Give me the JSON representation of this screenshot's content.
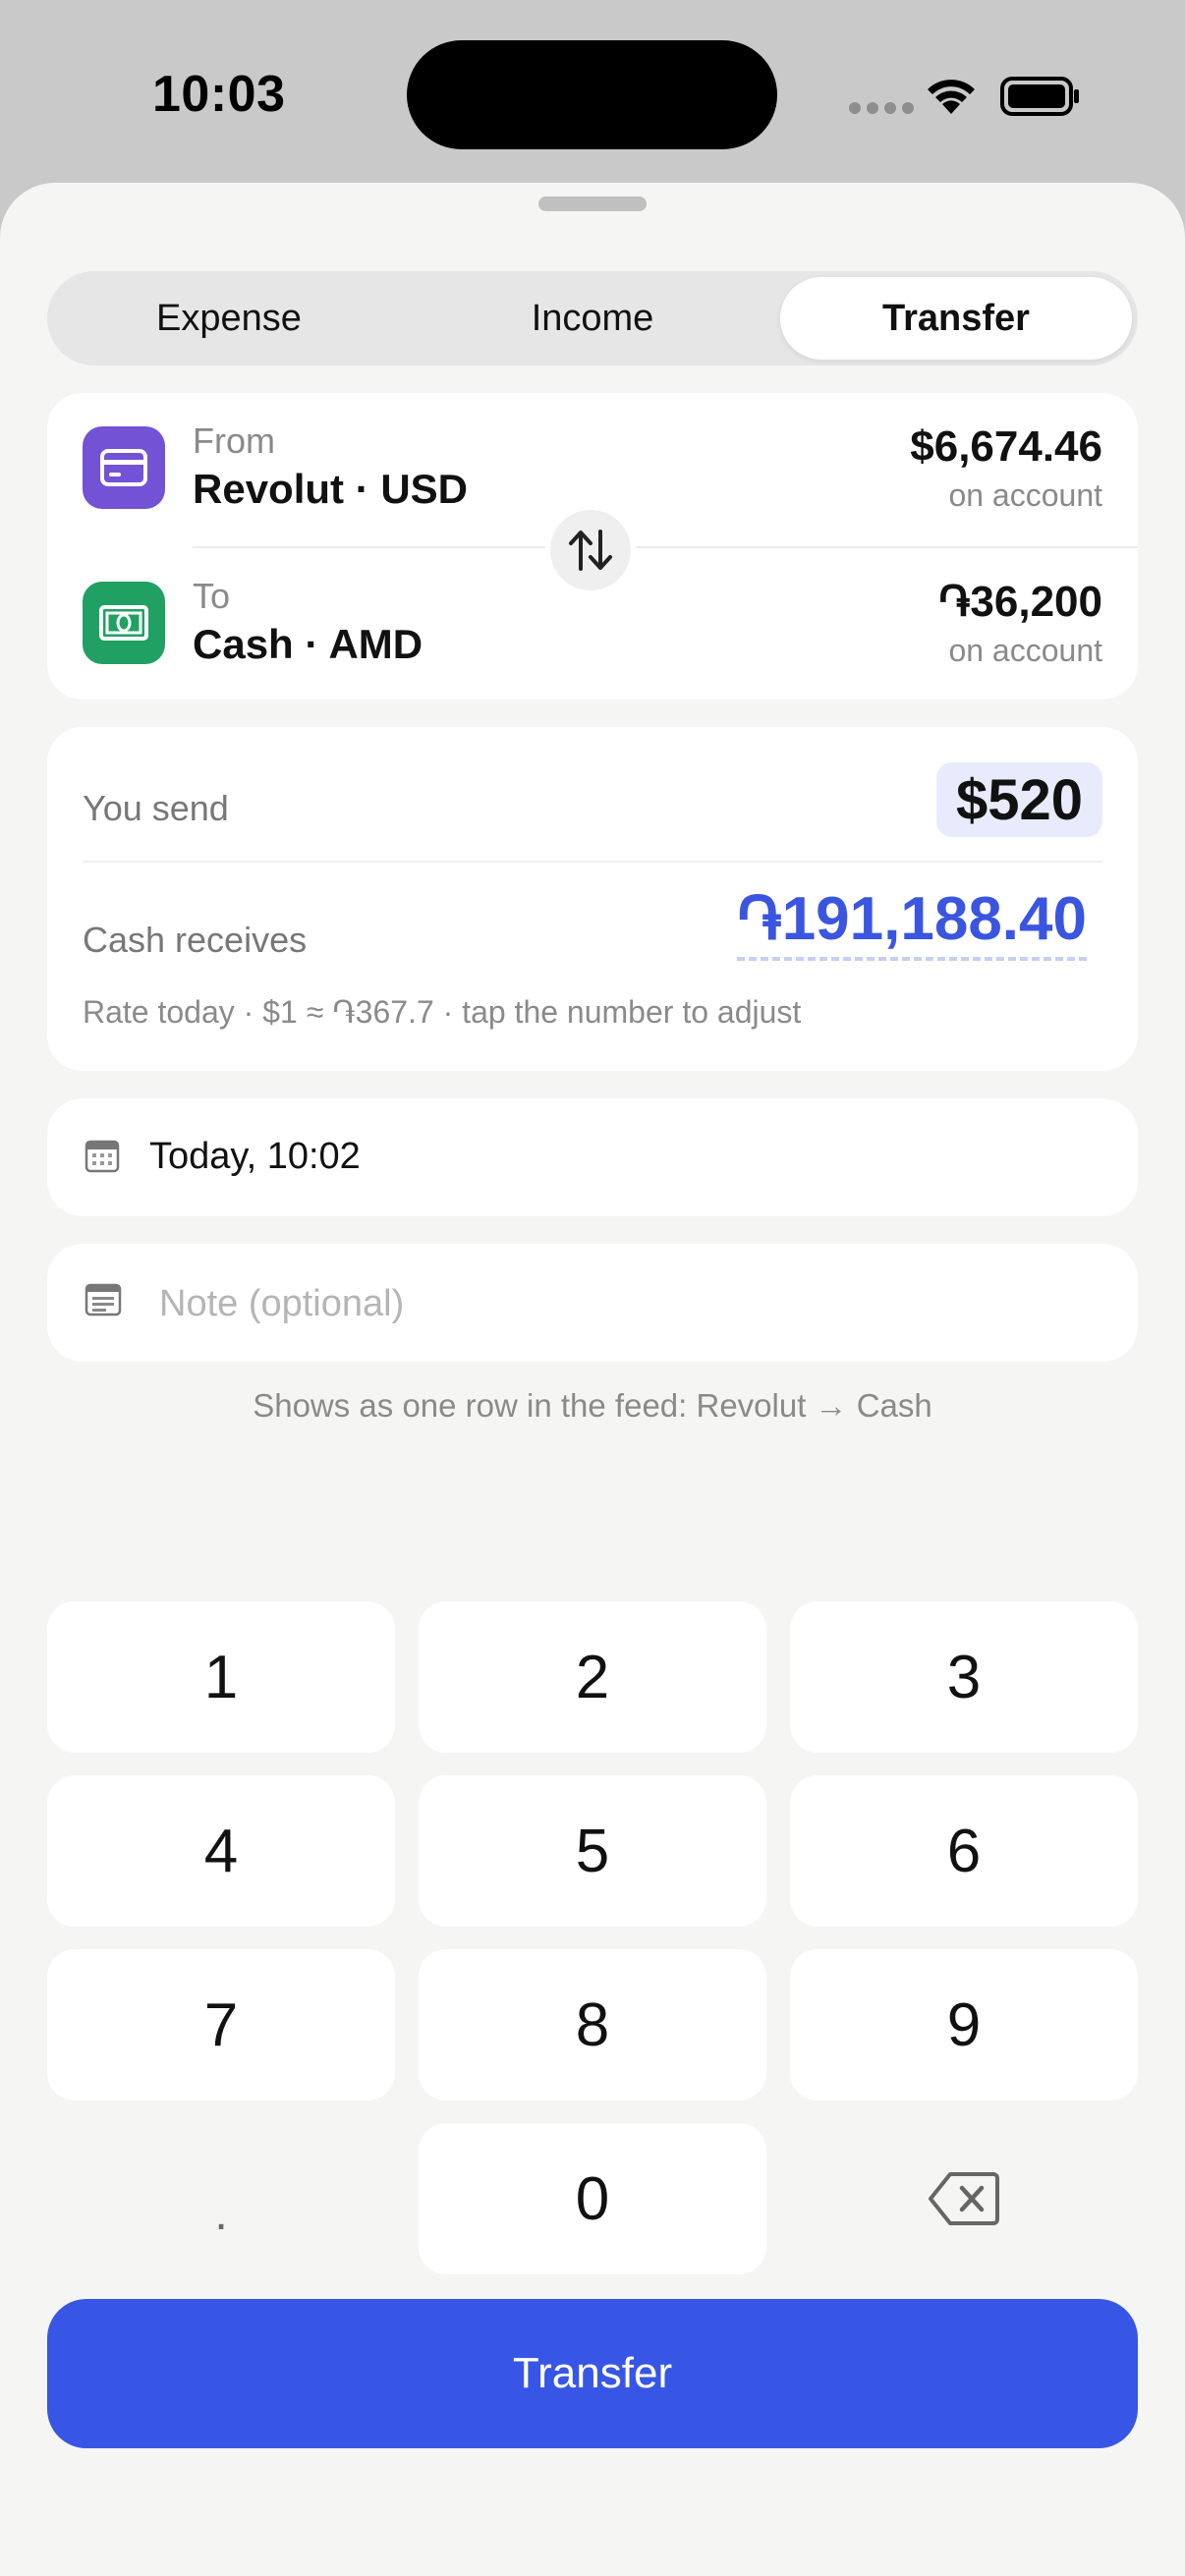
{
  "status_bar": {
    "time": "10:03"
  },
  "segments": [
    {
      "label": "Expense",
      "active": false
    },
    {
      "label": "Income",
      "active": false
    },
    {
      "label": "Transfer",
      "active": true
    }
  ],
  "accounts": {
    "from": {
      "label": "From",
      "name": "Revolut · USD",
      "balance": "$6,674.46",
      "balance_sub": "on account",
      "icon": "card-icon",
      "color": "#7352d6"
    },
    "to": {
      "label": "To",
      "name": "Cash · AMD",
      "balance": "֏36,200",
      "balance_sub": "on account",
      "icon": "cash-icon",
      "color": "#21a064"
    },
    "swap_icon": "swap-arrows-icon"
  },
  "amounts": {
    "send_label": "You send",
    "send_value": "$520",
    "receive_label": "Cash receives",
    "receive_value": "֏191,188.40",
    "rate_hint": "Rate today · $1 ≈ ֏367.7 · tap the number to adjust",
    "accent": "#3a55e0"
  },
  "date": {
    "value": "Today, 10:02",
    "icon": "calendar-icon"
  },
  "note": {
    "placeholder": "Note (optional)",
    "value": "",
    "icon": "note-icon"
  },
  "feed_hint": "Shows as one row in the feed: Revolut → Cash",
  "keypad": {
    "keys": [
      "1",
      "2",
      "3",
      "4",
      "5",
      "6",
      "7",
      "8",
      "9",
      ".",
      "0"
    ],
    "backspace_icon": "backspace-icon"
  },
  "cta": {
    "label": "Transfer",
    "color": "#3756e5"
  }
}
